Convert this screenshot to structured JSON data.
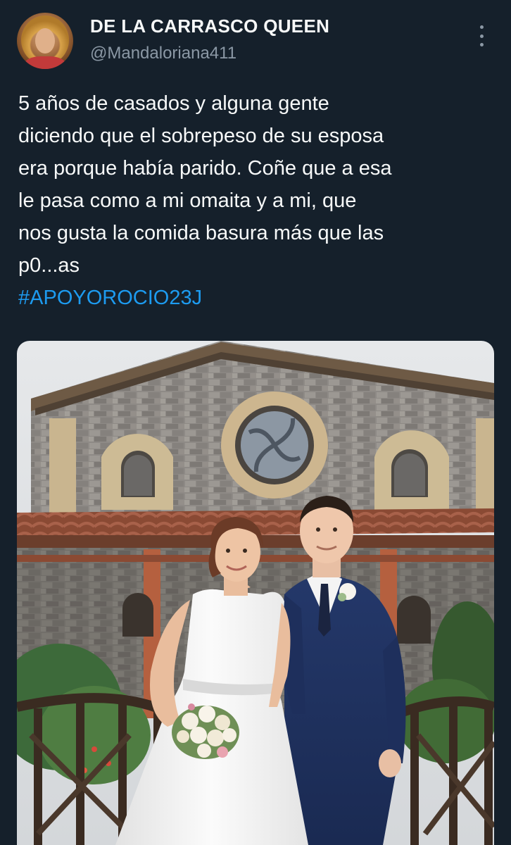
{
  "tweet": {
    "author": {
      "display_name": "DE LA CARRASCO QUEEN",
      "handle": "@Mandaloriana411"
    },
    "text": "5 años de casados y alguna gente\ndiciendo que el sobrepeso de su esposa\nera porque había parido. Coñe que a esa\nle pasa como a mi omaita y a mi, que\nnos gusta la comida basura más que las\np0...as",
    "hashtag": "#APOYOROCIO23J",
    "more_icon": "more-vertical-icon"
  },
  "colors": {
    "background": "#15202b",
    "text": "#f7f9f9",
    "secondary_text": "#8b98a5",
    "link": "#1d9bf0"
  }
}
